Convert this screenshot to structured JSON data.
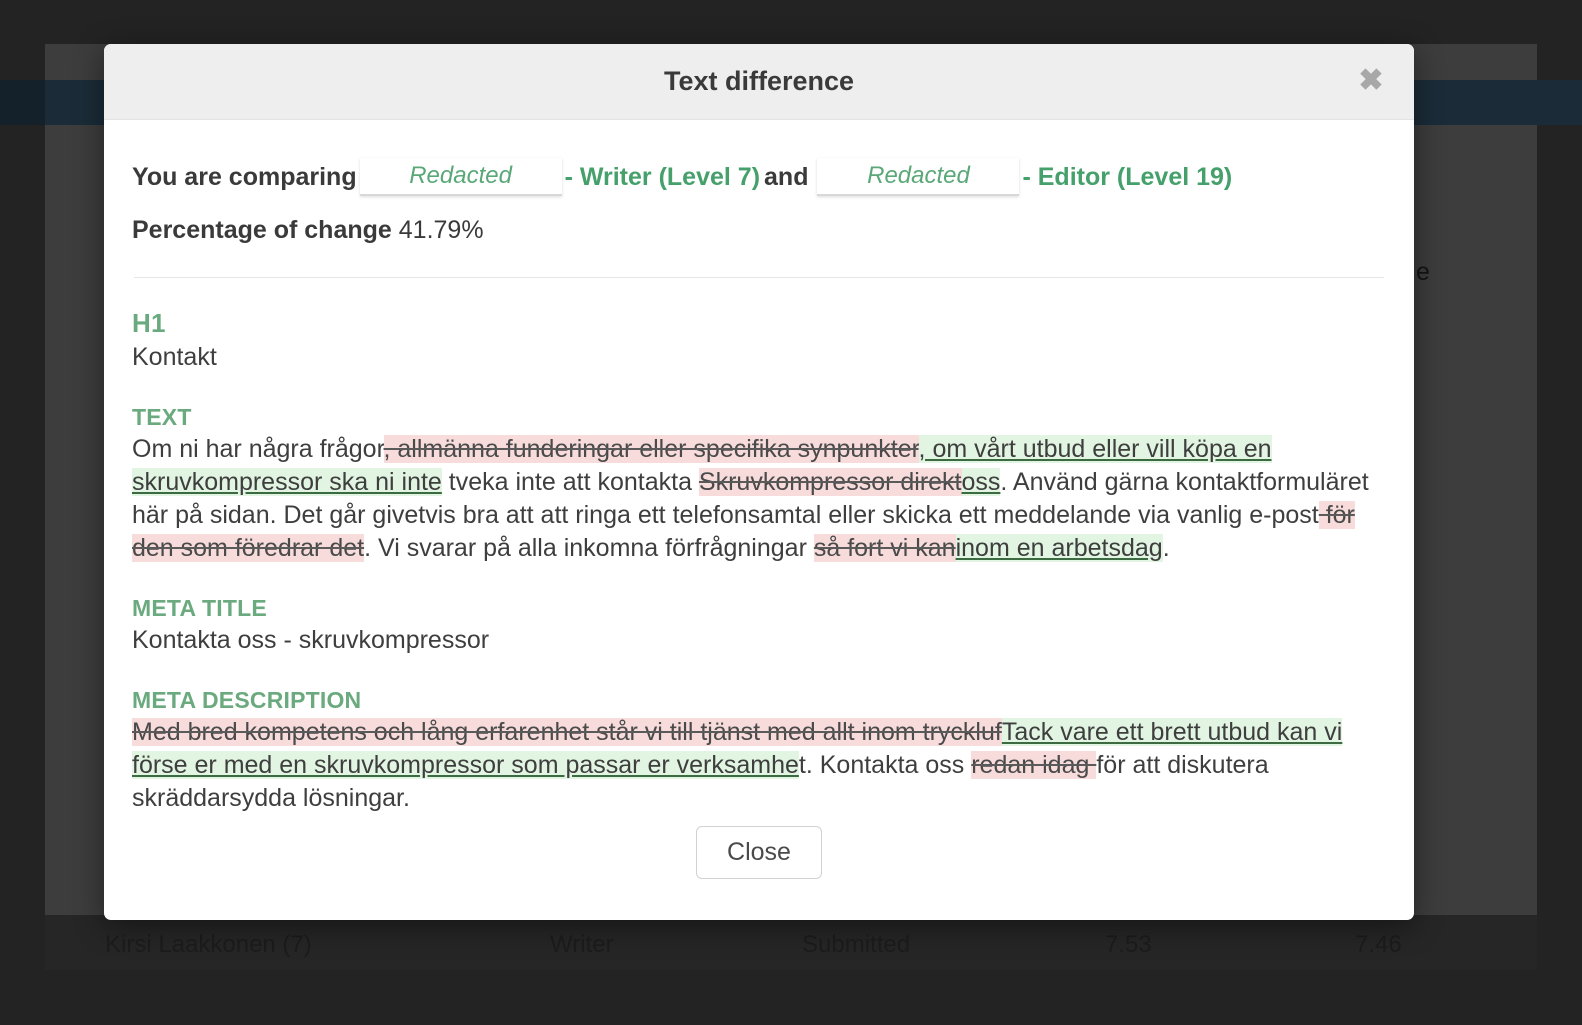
{
  "background": {
    "ghost_letter": "e",
    "row": {
      "user": "Kirsi Laakkonen (7)",
      "role": "Writer",
      "status": "Submitted",
      "score_a": "7.53",
      "score_b": "7.46"
    }
  },
  "modal": {
    "title": "Text difference",
    "close_icon": "close-x-icon",
    "comparing": {
      "prefix": "You are comparing",
      "user_a_redacted": "Redacted",
      "user_a_role": "- Writer (Level 7)",
      "conjunction": "and",
      "user_b_redacted": "Redacted",
      "user_b_role": "- Editor (Level 19)"
    },
    "percentage": {
      "label": "Percentage of change",
      "value": "41.79%"
    },
    "sections": {
      "h1": {
        "label": "H1",
        "text": "Kontakt"
      },
      "text": {
        "label": "TEXT",
        "parts": [
          {
            "type": "equal",
            "text": "Om ni har några frågor"
          },
          {
            "type": "removed",
            "text": ", allmänna funderingar eller specifika synpunkter"
          },
          {
            "type": "added",
            "text": ", om vårt utbud eller vill köpa en skruvkompressor ska ni inte"
          },
          {
            "type": "equal",
            "text": " tveka inte att kontakta "
          },
          {
            "type": "removed",
            "text": "Skruvkompressor direkt"
          },
          {
            "type": "added",
            "text": "oss"
          },
          {
            "type": "equal",
            "text": ". Använd gärna kontaktformuläret här på sidan. Det går givetvis bra att att ringa ett telefonsamtal eller skicka ett meddelande via vanlig e-post"
          },
          {
            "type": "removed",
            "text": " för den som föredrar det"
          },
          {
            "type": "equal",
            "text": ". Vi svarar på alla inkomna förfrågningar "
          },
          {
            "type": "removed",
            "text": "så fort vi kan"
          },
          {
            "type": "added",
            "text": "inom en arbetsdag"
          },
          {
            "type": "equal",
            "text": "."
          }
        ]
      },
      "meta_title": {
        "label": "META TITLE",
        "text": "Kontakta oss - skruvkompressor"
      },
      "meta_description": {
        "label": "META DESCRIPTION",
        "parts": [
          {
            "type": "removed",
            "text": "Med bred kompetens och lång erfarenhet står vi till tjänst med allt inom tryckluf"
          },
          {
            "type": "added",
            "text": "Tack vare ett brett utbud kan vi förse er med en skruvkompressor som passar er verksamhe"
          },
          {
            "type": "equal",
            "text": "t. Kontakta oss "
          },
          {
            "type": "removed",
            "text": "redan idag "
          },
          {
            "type": "equal",
            "text": "för att diskutera skräddarsydda lösningar."
          }
        ]
      }
    },
    "close_button_label": "Close"
  },
  "colors": {
    "added_bg": "#e2f5e2",
    "removed_bg": "#f8dcdc",
    "section_label": "#6aaa7e",
    "role_green": "#45a06b",
    "header_bg": "#eeeeee"
  }
}
